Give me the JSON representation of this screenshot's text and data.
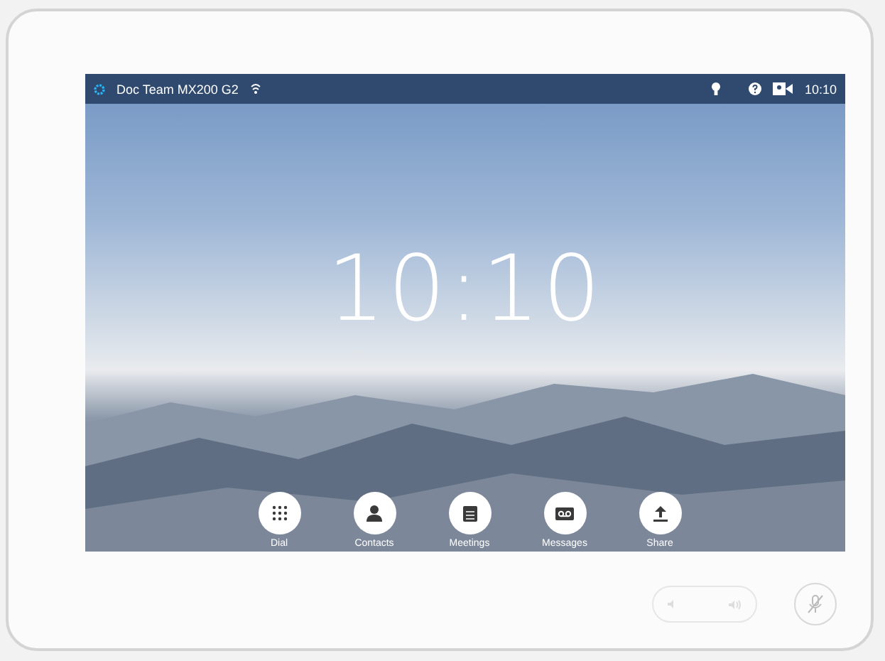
{
  "status_bar": {
    "device_name": "Doc Team MX200 G2",
    "time": "10:10"
  },
  "clock": "10:10",
  "actions": [
    {
      "label": "Dial",
      "kind": "dial"
    },
    {
      "label": "Contacts",
      "kind": "contacts"
    },
    {
      "label": "Meetings",
      "kind": "meetings"
    },
    {
      "label": "Messages",
      "kind": "messages"
    },
    {
      "label": "Share",
      "kind": "share"
    }
  ]
}
